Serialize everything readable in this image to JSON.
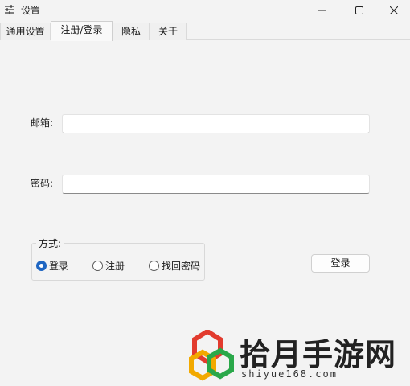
{
  "window": {
    "title": "设置",
    "icon": "sliders-icon",
    "controls": [
      "minimize-icon",
      "maximize-icon",
      "close-icon"
    ]
  },
  "tabs": [
    {
      "label": "通用设置",
      "active": false
    },
    {
      "label": "注册/登录",
      "active": true
    },
    {
      "label": "隐私",
      "active": false
    },
    {
      "label": "关于",
      "active": false
    }
  ],
  "form": {
    "email_label": "邮箱:",
    "email_value": "",
    "password_label": "密码:",
    "password_value": ""
  },
  "mode": {
    "legend": "方式:",
    "options": [
      {
        "label": "登录",
        "checked": true
      },
      {
        "label": "注册",
        "checked": false
      },
      {
        "label": "找回密码",
        "checked": false
      }
    ]
  },
  "action": {
    "label": "登录"
  },
  "watermark": {
    "text": "拾月手游网",
    "url": "shiyue168.com"
  },
  "colors": {
    "accent": "#1f66c2",
    "background": "#f3f3f3"
  }
}
